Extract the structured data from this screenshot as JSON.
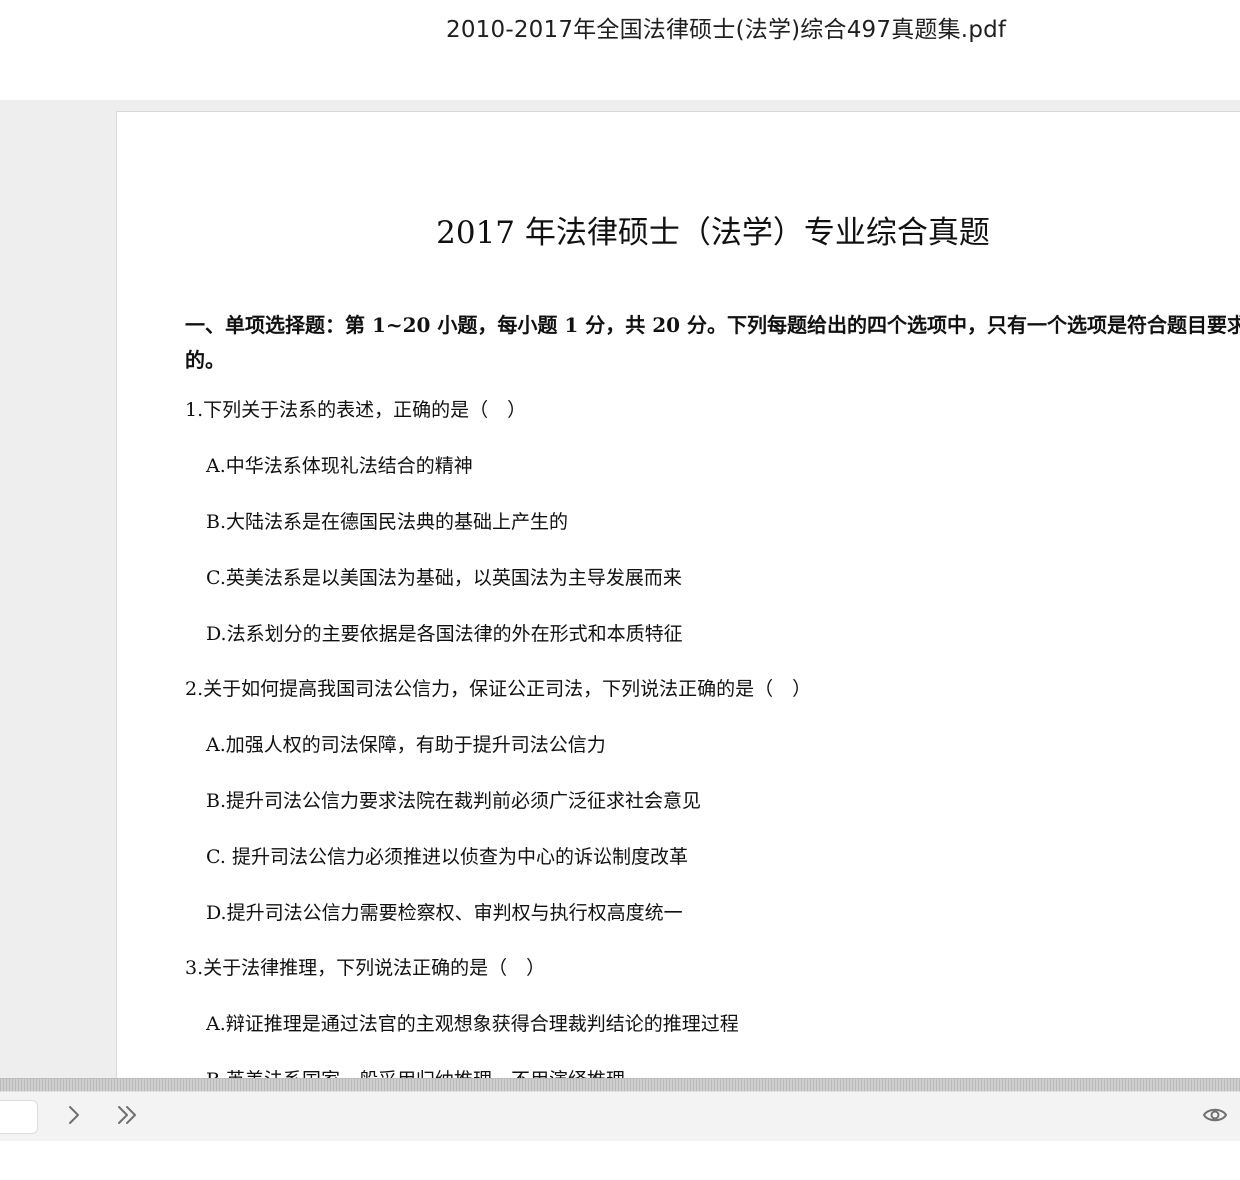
{
  "window": {
    "file_title": "2010-2017年全国法律硕士(法学)综合497真题集.pdf"
  },
  "document": {
    "title": "2017 年法律硕士（法学）专业综合真题",
    "section_heading": "一、单项选择题：第 1~20 小题，每小题 1 分，共 20 分。下列每题给出的四个选项中，只有一个选项是符合题目要求的。",
    "questions": [
      {
        "stem": "1.下列关于法系的表述，正确的是（　）",
        "options": [
          "A.中华法系体现礼法结合的精神",
          "B.大陆法系是在德国民法典的基础上产生的",
          "C.英美法系是以美国法为基础，以英国法为主导发展而来",
          "D.法系划分的主要依据是各国法律的外在形式和本质特征"
        ]
      },
      {
        "stem": "2.关于如何提高我国司法公信力，保证公正司法，下列说法正确的是（　）",
        "options": [
          "A.加强人权的司法保障，有助于提升司法公信力",
          "B.提升司法公信力要求法院在裁判前必须广泛征求社会意见",
          "C.  提升司法公信力必须推进以侦查为中心的诉讼制度改革",
          "D.提升司法公信力需要检察权、审判权与执行权高度统一"
        ]
      },
      {
        "stem": "3.关于法律推理，下列说法正确的是（　）",
        "options": [
          "A.辩证推理是通过法官的主观想象获得合理裁判结论的推理过程",
          "B.英美法系国家一般采用归纳推理，不用演绎推理"
        ]
      }
    ]
  },
  "toolbar": {
    "page_input_value": "",
    "icons": {
      "next": "chevron-right-icon",
      "last": "double-chevron-right-icon",
      "view": "eye-icon"
    }
  },
  "colors": {
    "viewer_background": "#eeeeee",
    "toolbar_background": "#f3f3f3",
    "icon": "#707070"
  }
}
